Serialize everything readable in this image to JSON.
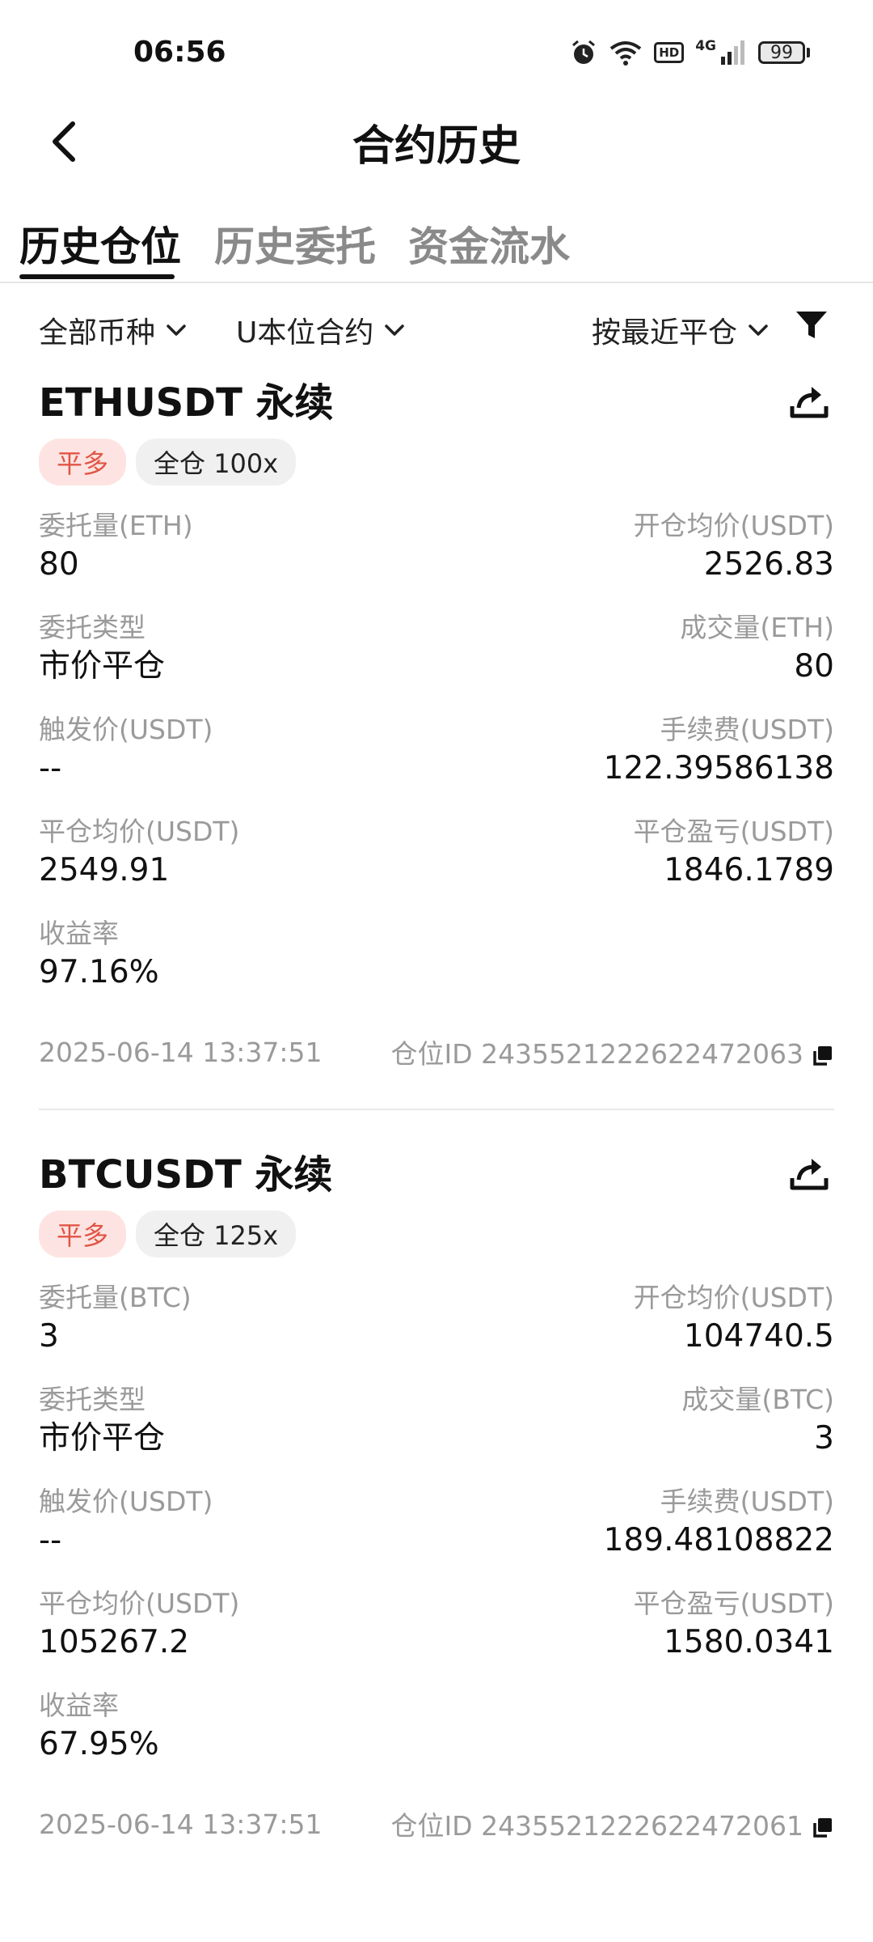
{
  "status_bar": {
    "time": "06:56",
    "network": "4G",
    "hd": "HD",
    "battery": "99"
  },
  "header": {
    "title": "合约历史"
  },
  "tabs": [
    {
      "label": "历史仓位",
      "active": true
    },
    {
      "label": "历史委托",
      "active": false
    },
    {
      "label": "资金流水",
      "active": false
    }
  ],
  "filters": {
    "coin": "全部币种",
    "contract": "U本位合约",
    "sort": "按最近平仓"
  },
  "positions": [
    {
      "symbol": "ETHUSDT 永续",
      "side": "平多",
      "mode": "全仓 100x",
      "order_qty_label": "委托量(ETH)",
      "order_qty": "80",
      "open_avg_label": "开仓均价(USDT)",
      "open_avg": "2526.83",
      "order_type_label": "委托类型",
      "order_type": "市价平仓",
      "filled_label": "成交量(ETH)",
      "filled": "80",
      "trigger_label": "触发价(USDT)",
      "trigger": "--",
      "fee_label": "手续费(USDT)",
      "fee": "122.39586138",
      "close_avg_label": "平仓均价(USDT)",
      "close_avg": "2549.91",
      "pnl_label": "平仓盈亏(USDT)",
      "pnl": "1846.1789",
      "roi_label": "收益率",
      "roi": "97.16%",
      "time": "2025-06-14 13:37:51",
      "position_id": "仓位ID 2435521222622472063"
    },
    {
      "symbol": "BTCUSDT 永续",
      "side": "平多",
      "mode": "全仓 125x",
      "order_qty_label": "委托量(BTC)",
      "order_qty": "3",
      "open_avg_label": "开仓均价(USDT)",
      "open_avg": "104740.5",
      "order_type_label": "委托类型",
      "order_type": "市价平仓",
      "filled_label": "成交量(BTC)",
      "filled": "3",
      "trigger_label": "触发价(USDT)",
      "trigger": "--",
      "fee_label": "手续费(USDT)",
      "fee": "189.48108822",
      "close_avg_label": "平仓均价(USDT)",
      "close_avg": "105267.2",
      "pnl_label": "平仓盈亏(USDT)",
      "pnl": "1580.0341",
      "roi_label": "收益率",
      "roi": "67.95%",
      "time": "2025-06-14 13:37:51",
      "position_id": "仓位ID 2435521222622472061"
    }
  ],
  "colors": {
    "accent_red": "#e05545",
    "side_badge_bg": "#fde4e2",
    "muted_text": "#9a9a9a"
  },
  "icons": [
    "alarm-icon",
    "wifi-icon",
    "signal-icon",
    "battery-icon",
    "back-arrow-icon",
    "chevron-down-icon",
    "filter-icon",
    "share-icon",
    "copy-icon"
  ]
}
